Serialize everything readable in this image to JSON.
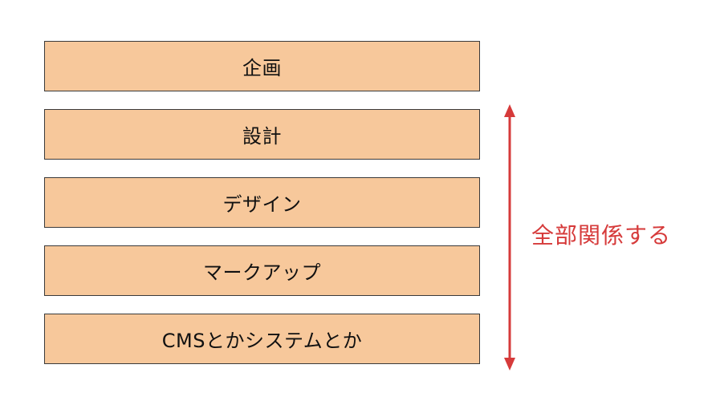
{
  "steps": [
    {
      "label": "企画"
    },
    {
      "label": "設計"
    },
    {
      "label": "デザイン"
    },
    {
      "label": "マークアップ"
    },
    {
      "label": "CMSとかシステムとか"
    }
  ],
  "arrow": {
    "label": "全部関係する",
    "color": "#d63a3a"
  },
  "colors": {
    "box_fill": "#f7c89b",
    "box_border": "#3a3a3a"
  }
}
